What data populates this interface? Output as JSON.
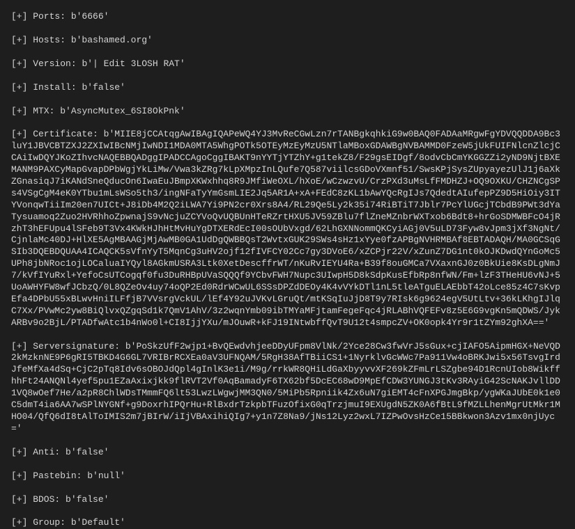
{
  "entries": [
    {
      "label": "[+] Ports:",
      "value": "b'6666'"
    },
    {
      "label": "[+] Hosts:",
      "value": "b'bashamed.org'"
    },
    {
      "label": "[+] Version:",
      "value": "b'| Edit 3LOSH RAT'"
    },
    {
      "label": "[+] Install:",
      "value": "b'false'"
    },
    {
      "label": "[+] MTX:",
      "value": "b'AsyncMutex_6SI8OkPnk'"
    },
    {
      "label": "[+] Certificate:",
      "value": "b'MIIE8jCCAtqgAwIBAgIQAPeWQ4YJ3MvReCGwLzn7rTANBgkqhkiG9w0BAQ0FADAaMRgwFgYDVQQDDA9Bc3luY1JBVCBTZXJ2ZXIwIBcNMjIwNDI1MDA0MTA5WhgPOTk5OTEyMzEyMzU5NTlaMBoxGDAWBgNVBAMMD0FzeW5jUkFUIFNlcnZlcjCCAiIwDQYJKoZIhvcNAQEBBQADggIPADCCAgoCggIBAKT9nYYTjYTZhY+g1tekZ8/F29gsEIDgf/8odvCbCmYKGGZZi2yND9NjtBXEMANM9PAXCyMapGvapDPbWgjYkLiMw/Vwa3kZRg7kLpXMpzInLQufe7Q587viilcsGDoVXmnf51/SwsKPjSysZUpyayezUlJ1j6aXkZGnasiqJ7iKANdSneQducOn6IwaEuJBmpXKWxhhq8R9JMfiWeOXL/hXoE/wCzwzvU/CrzPXd3uMsLfFMDHZJ+OQ9OXKU/CHZNCgSPs4VSgCgM4eK0YTbu1mLsWSo5th3/ingNFaTyYmGsmLIE2Jq5AR1A+xA+FEdC8zKL1bAwYQcRgIJs7QdedtAIufepPZ9D5HiOiy3ITYVonqwTiiIm20en7UICt+J8iDb4M2Q2iLWA7Yi9PN2cr0Xrs8A4/RL29Qe5Ly2k35i74RiBTiT7Jblr7PcYlUGcjTCbdB9PWt3dYaTysuamoq2Zuo2HVRhhoZpwnajS9vNcjuZCYVoQvUQBUnHTeRZrtHXU5JV59ZBlu7flZneMZnbrWXTxob6Bdt8+hrGoSDMWBFcO4jRzhT3hEFUpu4lSFeb9T3Vx4KWkHJhHtMvHuYgDTXERdEcI00sOUbVxgd/62LhGXNNommQKCyiAGj0V5uLD73Fyw8vJpm3jXf3NgNt/CjnlaMc40DJ+HlXE5AgMBAAGjMjAwMB0GA1UdDgQWBBQsT2WvtxGUK29SWs4sHz1xYye0fzAPBgNVHRMBAf8EBTADAQH/MA0GCSqGSIb3DQEBDQUAA4ICAQCK5sVfnYyT5MqnCg3uHV2ojf12fIVFCY02Cc7gy3DVoE6/xZCPjr22V/xZunZ7DG1nt0kOJKDwdQYnGoMc5UPh8jbNRoc1ojLOCaluaIYQyl8AGkmUSRA3Ltk0XetDescffrWT/nKuRvIEYU4Ra+B39f8ouGMCa7VXaxnGJ0z0BkUie8KsDLgNmJ7/kVfIYuRxl+YefoCsUTCogqf0fu3DuRHBpUVaSQQQf9YCbvFWH7Nupc3UIwpH5D8kSdpKusEfbRp8nfWN/Fm+lzF3THeHU6vNJ+5UoAWHYFW8wfJCbzQ/0L8QZeOv4uy74oQP2Ed0RdrWCwUL6SSsDPZdDEOy4K4vVYkDTl1nL5tleATguELAEbbT42oLce85z4C7sKvpEfa4DPbU55xBLwvHniILFfjB7VVsrgVckUL/lEf4Y92uJVKvLGruQt/mtKSqIuJjD8T9y7RIsk6g9624egV5UtLtv+36kLKhgIJlqC7Xx/PVwMc2yw8BiQlvxQZgqSd1k7QmV1AhV/3z2wqnYmb09ibTMYaMFjtamFegeFqc4jRLABhVQFEFv8z5E6G9vgKn5mQDWS/JykARBv9o2BjL/PTADfwAtc1b4nWo0l+CI8IjjYXu/mJOuwR+kFJ19INtwbffQvT9U12t4smpcZV+OK0opk4Yr9r1tZYm92ghXA=='",
      "long": true
    },
    {
      "label": "[+] Serversignature:",
      "value": "b'PoSkzUfF2wjp1+BvQEwdvhjeeDDyUFpm8VlNk/2Yce28Cw3fwVrJ5sGux+cjIAFO5AipmHGX+NeVQD2kMzknNE9P6gRI5TBKD4G6GL7VRIBrRCXEa0aV3UFNQAM/5RgH38AfTBiiCS1+1NyrklvGcWWc7Pa911Vw4oBRKJwi5x56TsvgIrdJfeMfXa4dSq+CjC2pTq8Idv6sOBOJdQpl4gInlK3e1i/M9g/rrkWR8QHiLdGaXbyyvvXF269kZFmLrLSZgbe94D1RcnUIob8WikffhhFt24ANQNl4yef5pu1EZaAxixjkk9flRVT2Vf0AqBamadyF6TX62bf5DcEC68wD9MpEfCDW3YUNGJ3tKv3RAyiG42ScNAKJvllDD1VQ8wOef7He/a2pR8ChlWDsTMmmFQ6lt53LwzLWgwjMM3QN0/5MiPb5Rpniik4Zx6uN7giEMT4cFnXPGJmgBkp/ygWKaJUbE0k1e0C5dmT4ia6AA7wSPlNYGNf+g9DoxrhIPQrHu+RlBxdrTzkpbTFuzOfixG0qTrzjmuI9EXUgdN5ZK0A6fBtL9fMZLLhenMgrUtMkr1MHO04/QfQ6dI8tAlToIMIS2m7jBIrW/iIjVBAxihiQIg7+y1n7Z8Na9/jNs12Lyz2wxL7IZPwOvsHzCe15BBkwon3Azv1mx0njUyc='",
      "long": true
    },
    {
      "label": "[+] Anti:",
      "value": "b'false'"
    },
    {
      "label": "[+] Pastebin:",
      "value": "b'null'"
    },
    {
      "label": "[+] BDOS:",
      "value": "b'false'"
    },
    {
      "label": "[+] Group:",
      "value": "b'Default'"
    }
  ]
}
